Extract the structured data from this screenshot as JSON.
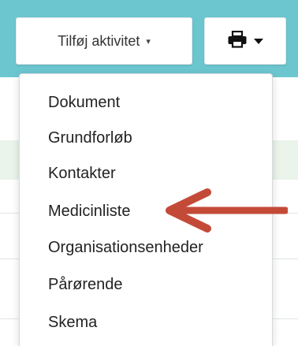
{
  "toolbar": {
    "add_activity_label": "Tilføj aktivitet",
    "add_activity_caret": "▾",
    "print_icon": "printer-icon"
  },
  "dropdown": {
    "items": [
      {
        "label": "Dokument"
      },
      {
        "label": "Grundforløb"
      },
      {
        "label": "Kontakter"
      },
      {
        "label": "Medicinliste"
      },
      {
        "label": "Organisationsenheder"
      },
      {
        "label": "Pårørende"
      },
      {
        "label": "Skema"
      }
    ]
  },
  "annotation": {
    "arrow_color": "#c44a38",
    "target": "Medicinliste"
  },
  "colors": {
    "header": "#6cc6cf",
    "highlight_row": "#eaf4ea",
    "menu_bg": "#ffffff"
  }
}
